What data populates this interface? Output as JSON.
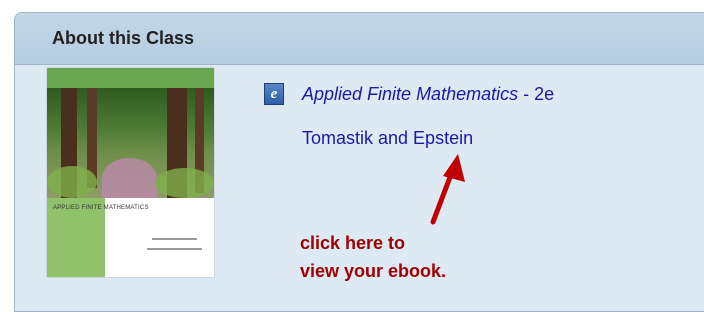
{
  "panel": {
    "title": "About this Class"
  },
  "cover": {
    "title_text": "APPLIED FINITE MATHEMATICS"
  },
  "book": {
    "icon": "ebook-e-icon",
    "title": "Applied Finite Mathematics",
    "edition": " - 2e",
    "authors": "Tomastik and Epstein"
  },
  "annotation": {
    "line1": "click here to",
    "line2": "view your ebook.",
    "color": "#a00000"
  },
  "colors": {
    "panel_bg": "#dde9f3",
    "header_bg": "#b4cde2",
    "link": "#1a1aa6",
    "cover_green": "#6aa84f"
  }
}
